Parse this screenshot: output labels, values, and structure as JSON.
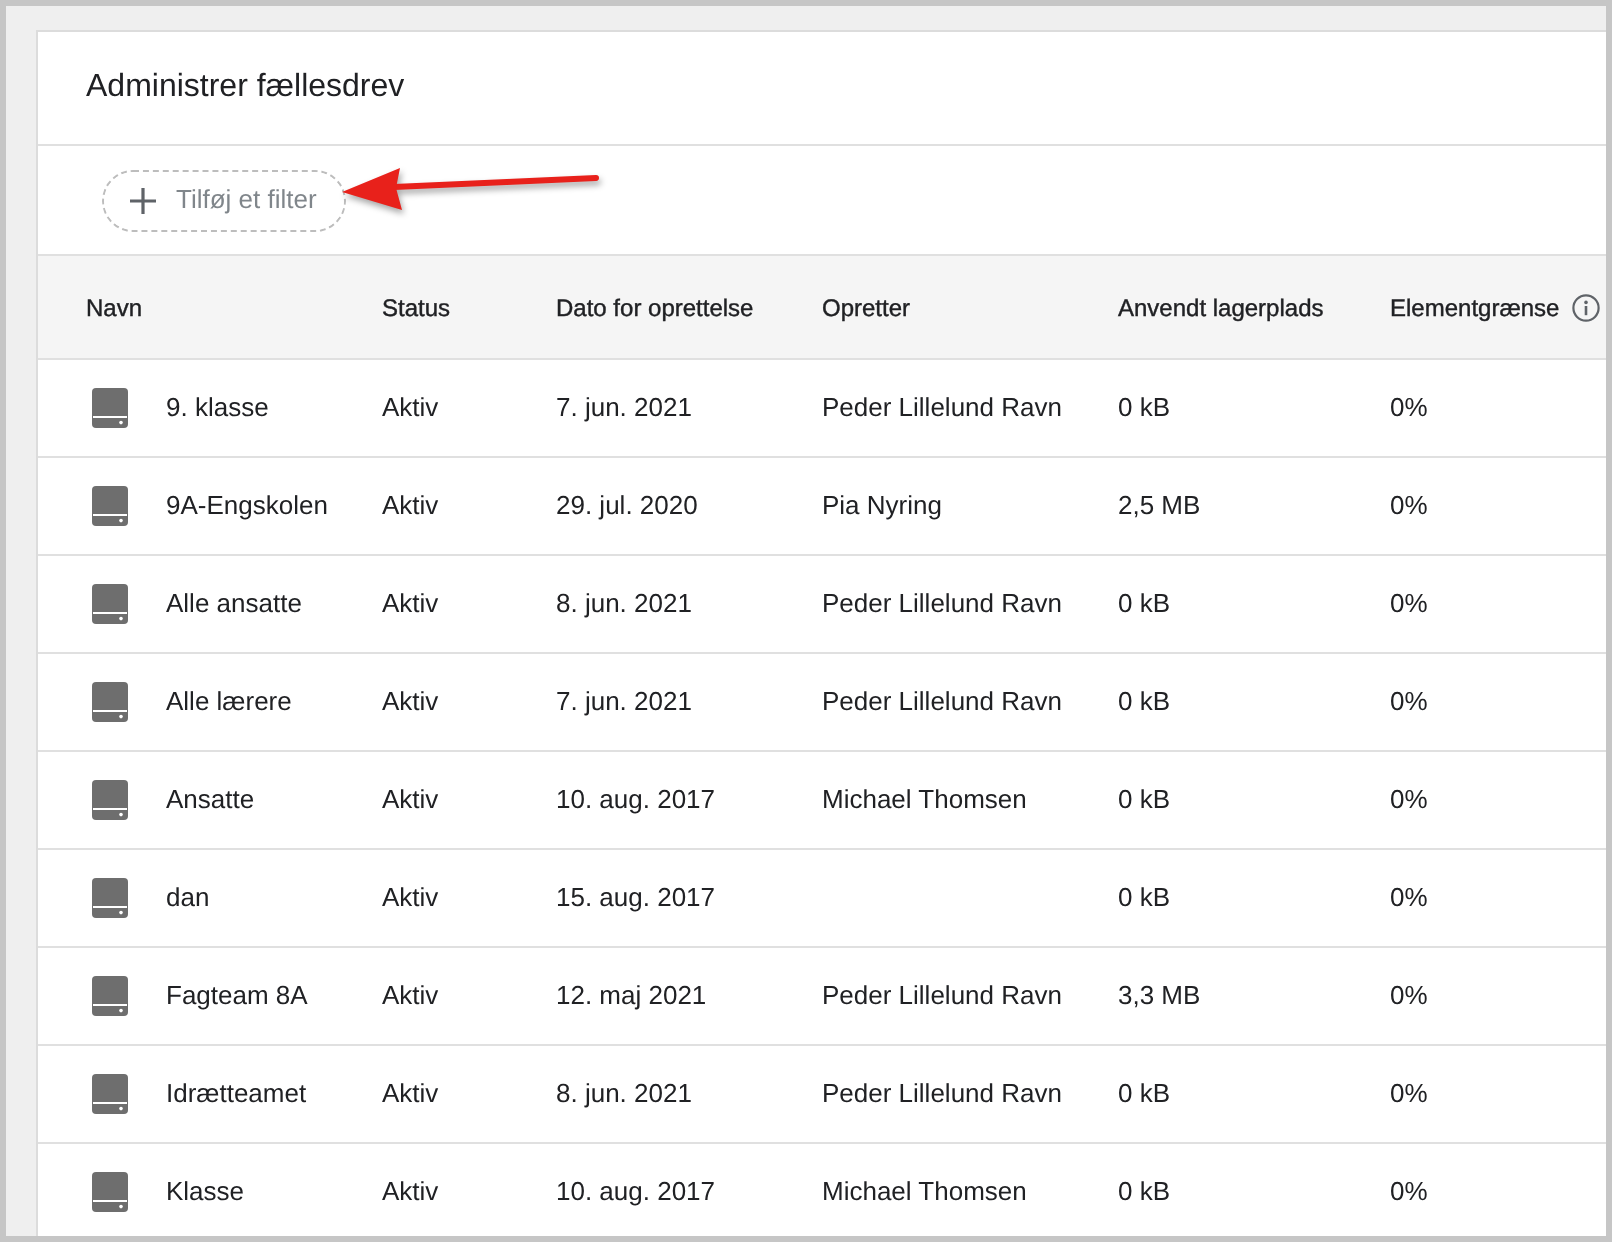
{
  "title": "Administrer fællesdrev",
  "filter_chip": {
    "label": "Tilføj et filter"
  },
  "annotations": [
    {
      "kind": "arrow"
    }
  ],
  "table": {
    "columns": [
      {
        "label": "Navn"
      },
      {
        "label": "Status"
      },
      {
        "label": "Dato for oprettelse"
      },
      {
        "label": "Opretter"
      },
      {
        "label": "Anvendt lagerplads"
      },
      {
        "label": "Elementgrænse",
        "info": true
      }
    ],
    "rows": [
      {
        "name": "9. klasse",
        "status": "Aktiv",
        "created": "7. jun. 2021",
        "creator": "Peder Lillelund Ravn",
        "storage": "0 kB",
        "item_limit": "0%"
      },
      {
        "name": "9A-Engskolen",
        "status": "Aktiv",
        "created": "29. jul. 2020",
        "creator": "Pia Nyring",
        "storage": "2,5 MB",
        "item_limit": "0%"
      },
      {
        "name": "Alle ansatte",
        "status": "Aktiv",
        "created": "8. jun. 2021",
        "creator": "Peder Lillelund Ravn",
        "storage": "0 kB",
        "item_limit": "0%"
      },
      {
        "name": "Alle lærere",
        "status": "Aktiv",
        "created": "7. jun. 2021",
        "creator": "Peder Lillelund Ravn",
        "storage": "0 kB",
        "item_limit": "0%"
      },
      {
        "name": "Ansatte",
        "status": "Aktiv",
        "created": "10. aug. 2017",
        "creator": "Michael Thomsen",
        "storage": "0 kB",
        "item_limit": "0%"
      },
      {
        "name": "dan",
        "status": "Aktiv",
        "created": "15. aug. 2017",
        "storage": "0 kB",
        "item_limit": "0%"
      },
      {
        "name": "Fagteam 8A",
        "status": "Aktiv",
        "created": "12. maj 2021",
        "creator": "Peder Lillelund Ravn",
        "storage": "3,3 MB",
        "item_limit": "0%"
      },
      {
        "name": "Idrætteamet",
        "status": "Aktiv",
        "created": "8. jun. 2021",
        "creator": "Peder Lillelund Ravn",
        "storage": "0 kB",
        "item_limit": "0%"
      },
      {
        "name": "Klasse",
        "status": "Aktiv",
        "created": "10. aug. 2017",
        "creator": "Michael Thomsen",
        "storage": "0 kB",
        "item_limit": "0%"
      }
    ]
  }
}
